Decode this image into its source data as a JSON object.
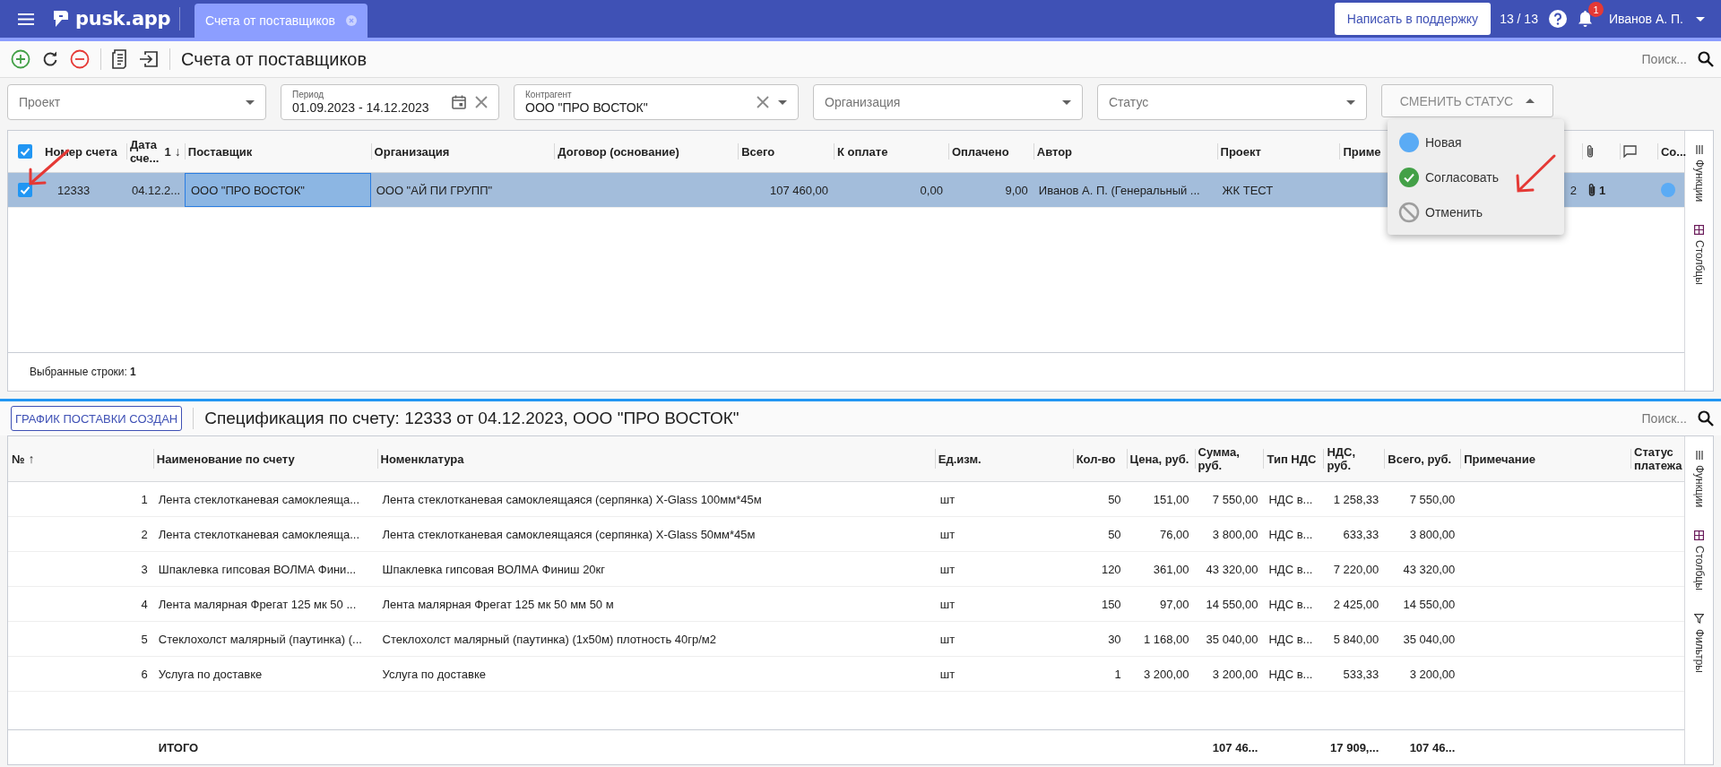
{
  "topbar": {
    "logo": "pusk.app",
    "tabs": [
      {
        "label": "Счета от поставщиков",
        "selected": true
      }
    ],
    "support_button": "Написать в поддержку",
    "counter": "13 / 13",
    "notifications_badge": "1",
    "user": "Иванов А. П."
  },
  "toolbar": {
    "title": "Счета от поставщиков",
    "search_placeholder": "Поиск..."
  },
  "filters": [
    {
      "kind": "select",
      "placeholder": "Проект"
    },
    {
      "kind": "date",
      "label": "Период",
      "value": "01.09.2023 - 14.12.2023"
    },
    {
      "kind": "select",
      "label": "Контрагент",
      "value": "ООО \"ПРО ВОСТОК\"",
      "clearable": true
    },
    {
      "kind": "select",
      "placeholder": "Организация"
    },
    {
      "kind": "select",
      "placeholder": "Статус"
    }
  ],
  "status_button": {
    "label": "СМЕНИТЬ СТАТУС",
    "expanded": true,
    "options": [
      {
        "kind": "new",
        "label": "Новая"
      },
      {
        "kind": "approve",
        "label": "Согласовать"
      },
      {
        "kind": "cancel",
        "label": "Отменить"
      }
    ]
  },
  "invoices": {
    "all_selected": true,
    "columns": [
      {
        "label": "Номер счета",
        "kind": "text"
      },
      {
        "label": "Дата сче...",
        "kind": "text",
        "sort_icon": "↓",
        "sort_order": "1"
      },
      {
        "label": "Поставщик",
        "kind": "text"
      },
      {
        "label": "Организация",
        "kind": "text"
      },
      {
        "label": "Договор (основание)",
        "kind": "text"
      },
      {
        "label": "Всего",
        "kind": "number"
      },
      {
        "label": "К оплате",
        "kind": "number"
      },
      {
        "label": "Оплачено",
        "kind": "number"
      },
      {
        "label": "Автор",
        "kind": "text"
      },
      {
        "label": "Проект",
        "kind": "text"
      },
      {
        "label": "Приме",
        "kind": "text"
      },
      {
        "kind": "number"
      },
      {
        "kind": "clip"
      },
      {
        "kind": "comment"
      },
      {
        "label": "Со...",
        "kind": "status"
      }
    ],
    "rows": [
      {
        "selected": true,
        "cells": [
          {
            "text": "12333",
            "focused": false
          },
          {
            "text": "04.12.2...",
            "focused": false
          },
          {
            "text": "ООО \"ПРО ВОСТОК\"",
            "focused": true
          },
          {
            "text": "ООО \"АЙ ПИ ГРУПП\"",
            "focused": false
          },
          {
            "focused": false
          },
          {
            "text": "107 460,00",
            "focused": false
          },
          {
            "text": "0,00",
            "focused": false
          },
          {
            "text": "9,00",
            "focused": false
          },
          {
            "text": "Иванов А. П. (Генеральный ...",
            "focused": false
          },
          {
            "text": "ЖК ТЕСТ",
            "focused": false
          },
          {
            "focused": false
          },
          {
            "text": "2",
            "focused": false
          },
          {
            "text": "1",
            "focused": false
          },
          {
            "focused": false
          },
          {
            "color": "#5aabf5",
            "focused": false
          }
        ]
      }
    ],
    "selected_rows_label": "Выбранные строки:",
    "selected_rows_count": "1",
    "side_tools": [
      {
        "kind": "functions",
        "label": "Функции"
      },
      {
        "kind": "columns",
        "label": "Столбцы"
      }
    ]
  },
  "spec": {
    "button": "ГРАФИК ПОСТАВКИ СОЗДАН",
    "title": "Спецификация по счету: 12333 от 04.12.2023, ООО \"ПРО ВОСТОК\"",
    "search_placeholder": "Поиск...",
    "columns": [
      {
        "label": "№",
        "kind": "number",
        "sort_icon": "↑"
      },
      {
        "label": "Наименование по счету",
        "kind": "text"
      },
      {
        "label": "Номенклатура",
        "kind": "text"
      },
      {
        "label": "Ед.изм.",
        "kind": "text"
      },
      {
        "label": "Кол-во",
        "kind": "number"
      },
      {
        "label": "Цена, руб.",
        "kind": "number"
      },
      {
        "label": "Сумма, руб.",
        "kind": "number"
      },
      {
        "label": "Тип НДС",
        "kind": "text"
      },
      {
        "label": "НДС, руб.",
        "kind": "number"
      },
      {
        "label": "Всего, руб.",
        "kind": "number"
      },
      {
        "label": "Примечание",
        "kind": "text"
      },
      {
        "label": "Статус платежа",
        "kind": "text"
      }
    ],
    "rows": [
      [
        "1",
        "Лента стеклотканевая самоклеяща...",
        "Лента стеклотканевая самоклеящаяся (серпянка) X-Glass 100мм*45м",
        "шт",
        "50",
        "151,00",
        "7 550,00",
        "НДС в...",
        "1 258,33",
        "7 550,00"
      ],
      [
        "2",
        "Лента стеклотканевая самоклеяща...",
        "Лента стеклотканевая самоклеящаяся (серпянка) X-Glass 50мм*45м",
        "шт",
        "50",
        "76,00",
        "3 800,00",
        "НДС в...",
        "633,33",
        "3 800,00"
      ],
      [
        "3",
        "Шпаклевка гипсовая ВОЛМА Фини...",
        "Шпаклевка гипсовая ВОЛМА Финиш 20кг",
        "шт",
        "120",
        "361,00",
        "43 320,00",
        "НДС в...",
        "7 220,00",
        "43 320,00"
      ],
      [
        "4",
        "Лента малярная Фрегат 125 мк 50 ...",
        "Лента малярная Фрегат 125 мк 50 мм 50 м",
        "шт",
        "150",
        "97,00",
        "14 550,00",
        "НДС в...",
        "2 425,00",
        "14 550,00"
      ],
      [
        "5",
        "Стеклохолст малярный (паутинка) (...",
        "Стеклохолст малярный (паутинка) (1х50м) плотность 40гр/м2",
        "шт",
        "30",
        "1 168,00",
        "35 040,00",
        "НДС в...",
        "5 840,00",
        "35 040,00"
      ],
      [
        "6",
        "Услуга по доставке",
        "Услуга по доставке",
        "шт",
        "1",
        "3 200,00",
        "3 200,00",
        "НДС в...",
        "533,33",
        "3 200,00"
      ]
    ],
    "total": {
      "label": "ИТОГО",
      "sum": "107 46...",
      "vat": "17 909,...",
      "total": "107 46..."
    },
    "side_tools": [
      {
        "kind": "functions",
        "label": "Функции"
      },
      {
        "kind": "columns",
        "label": "Столбцы"
      },
      {
        "kind": "filters",
        "label": "Фильтры"
      }
    ]
  }
}
